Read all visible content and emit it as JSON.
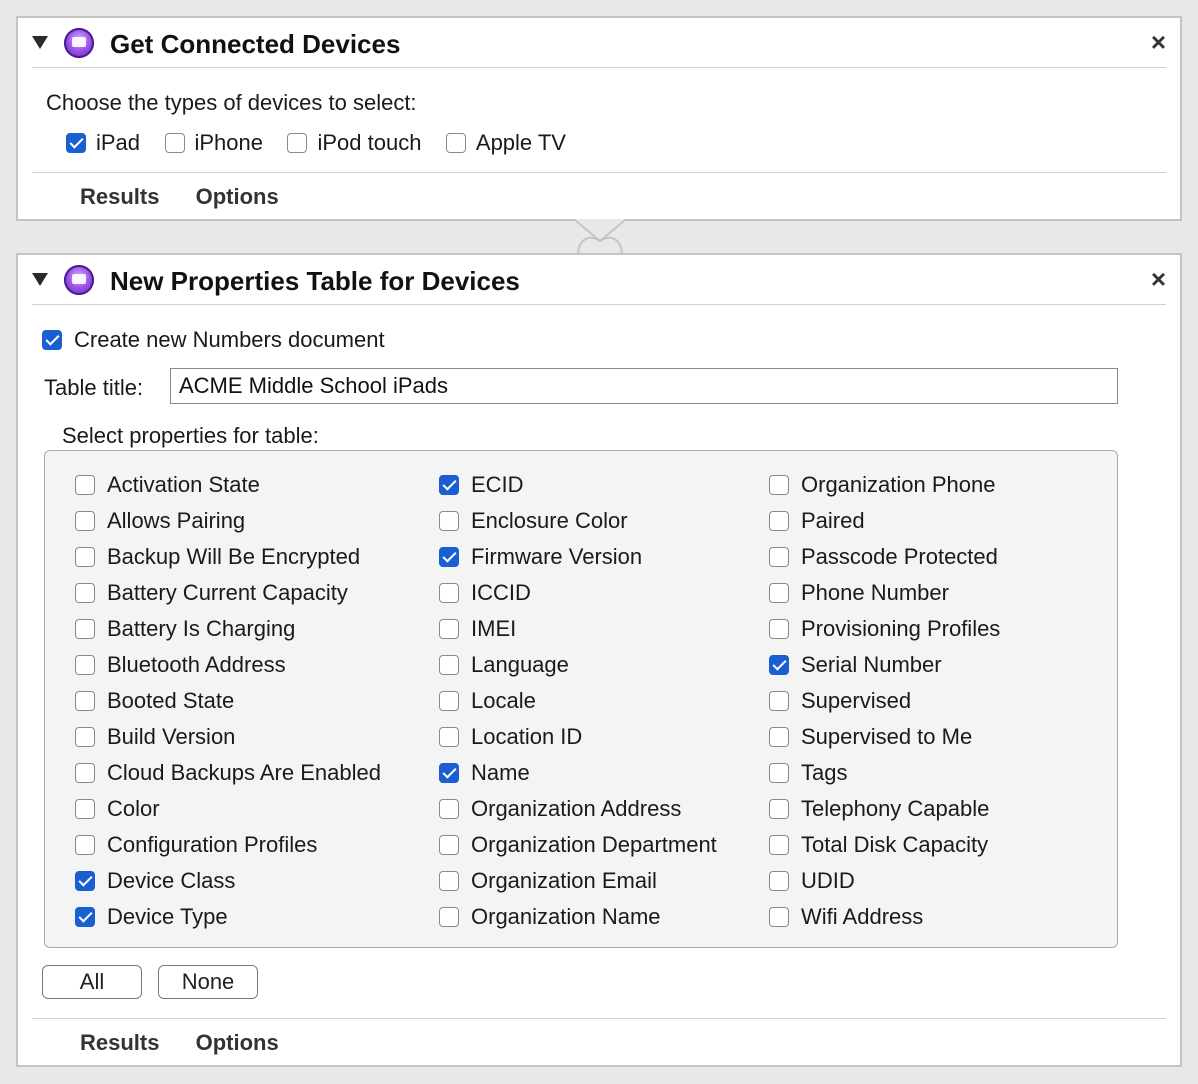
{
  "panel1": {
    "title": "Get Connected Devices",
    "close": "×",
    "prompt": "Choose the types of devices to select:",
    "devices": [
      {
        "label": "iPad",
        "checked": true
      },
      {
        "label": "iPhone",
        "checked": false
      },
      {
        "label": "iPod touch",
        "checked": false
      },
      {
        "label": "Apple TV",
        "checked": false
      }
    ],
    "tabs": {
      "results": "Results",
      "options": "Options"
    }
  },
  "panel2": {
    "title": "New Properties Table for Devices",
    "close": "×",
    "create_new": {
      "label": "Create new Numbers document",
      "checked": true
    },
    "table_title_label": "Table title:",
    "table_title_value": "ACME Middle School iPads",
    "select_label": "Select properties for table:",
    "columns": [
      [
        {
          "label": "Activation State",
          "checked": false
        },
        {
          "label": "Allows Pairing",
          "checked": false
        },
        {
          "label": "Backup Will Be Encrypted",
          "checked": false
        },
        {
          "label": "Battery Current Capacity",
          "checked": false
        },
        {
          "label": "Battery Is Charging",
          "checked": false
        },
        {
          "label": "Bluetooth Address",
          "checked": false
        },
        {
          "label": "Booted State",
          "checked": false
        },
        {
          "label": "Build Version",
          "checked": false
        },
        {
          "label": "Cloud Backups Are Enabled",
          "checked": false
        },
        {
          "label": "Color",
          "checked": false
        },
        {
          "label": "Configuration Profiles",
          "checked": false
        },
        {
          "label": "Device Class",
          "checked": true
        },
        {
          "label": "Device Type",
          "checked": true
        }
      ],
      [
        {
          "label": "ECID",
          "checked": true
        },
        {
          "label": "Enclosure Color",
          "checked": false
        },
        {
          "label": "Firmware Version",
          "checked": true
        },
        {
          "label": "ICCID",
          "checked": false
        },
        {
          "label": "IMEI",
          "checked": false
        },
        {
          "label": "Language",
          "checked": false
        },
        {
          "label": "Locale",
          "checked": false
        },
        {
          "label": "Location ID",
          "checked": false
        },
        {
          "label": "Name",
          "checked": true
        },
        {
          "label": "Organization Address",
          "checked": false
        },
        {
          "label": "Organization Department",
          "checked": false
        },
        {
          "label": "Organization Email",
          "checked": false
        },
        {
          "label": "Organization Name",
          "checked": false
        }
      ],
      [
        {
          "label": "Organization Phone",
          "checked": false
        },
        {
          "label": "Paired",
          "checked": false
        },
        {
          "label": "Passcode Protected",
          "checked": false
        },
        {
          "label": "Phone Number",
          "checked": false
        },
        {
          "label": "Provisioning Profiles",
          "checked": false
        },
        {
          "label": "Serial Number",
          "checked": true
        },
        {
          "label": "Supervised",
          "checked": false
        },
        {
          "label": "Supervised to Me",
          "checked": false
        },
        {
          "label": "Tags",
          "checked": false
        },
        {
          "label": "Telephony Capable",
          "checked": false
        },
        {
          "label": "Total Disk Capacity",
          "checked": false
        },
        {
          "label": "UDID",
          "checked": false
        },
        {
          "label": "Wifi Address",
          "checked": false
        }
      ]
    ],
    "buttons": {
      "all": "All",
      "none": "None"
    },
    "tabs": {
      "results": "Results",
      "options": "Options"
    }
  },
  "colors": {
    "accent": "#1a5fd1",
    "action_icon": "#9b56e6"
  },
  "icons": {
    "disclosure": "disclosure-triangle-icon",
    "action": "automator-action-icon",
    "close": "close-icon"
  }
}
